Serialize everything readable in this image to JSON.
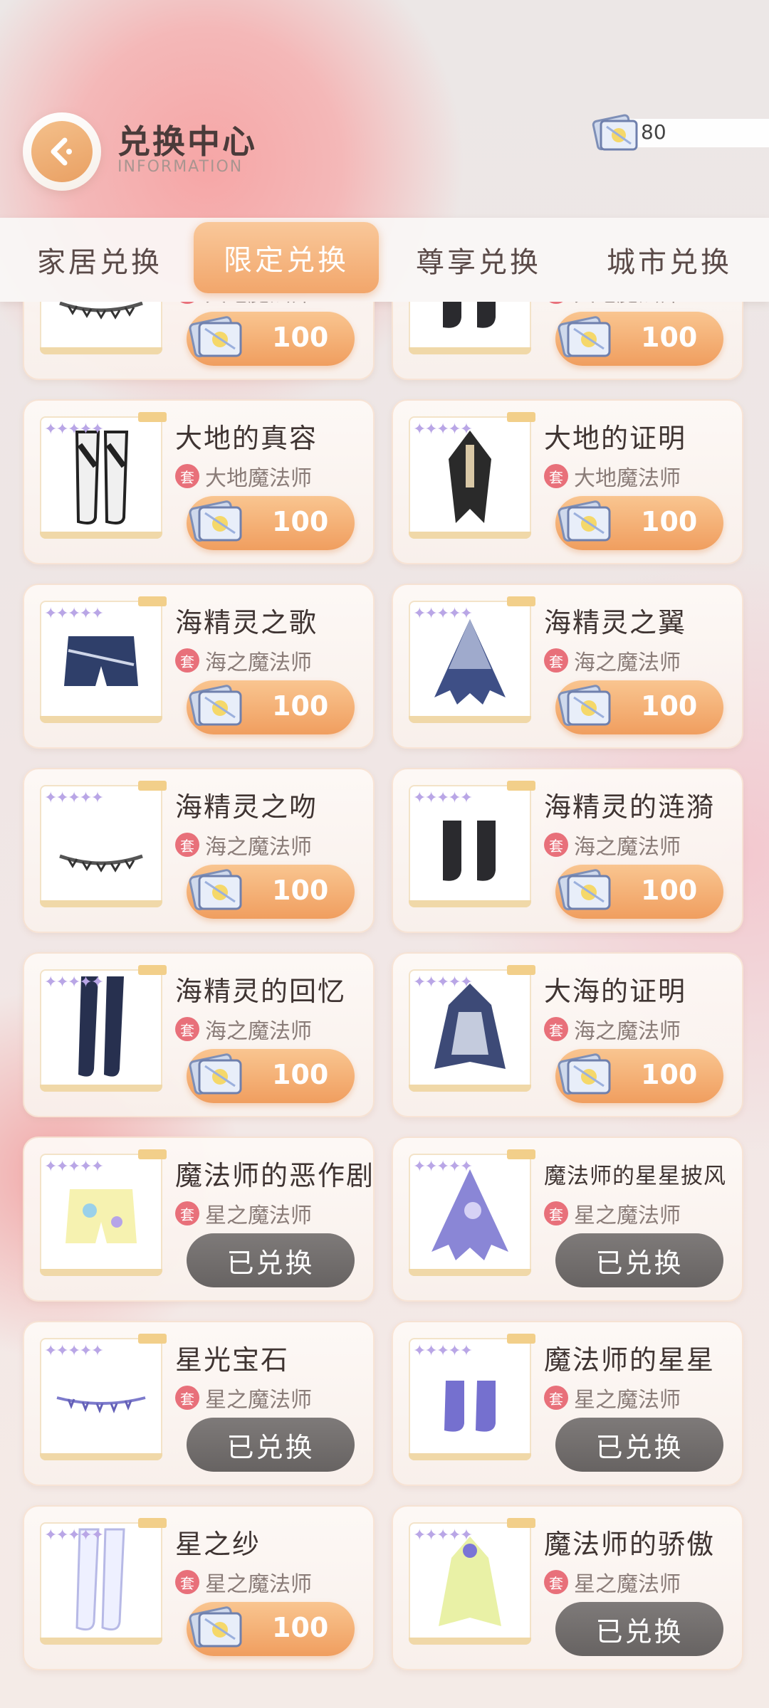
{
  "header": {
    "title": "兑换中心",
    "subtitle": "INFORMATION",
    "currency_value": "80",
    "back_icon": "back-arrow-icon"
  },
  "tabs": [
    "家居兑换",
    "限定兑换",
    "尊享兑换",
    "城市兑换"
  ],
  "active_tab": "限定兑换",
  "set_badge_text": "套",
  "redeemed_label": "已兑换",
  "items": [
    {
      "name": "",
      "set": "大地魔法师",
      "price": "100",
      "redeemed": false,
      "art": "necklace"
    },
    {
      "name": "",
      "set": "大地魔法师",
      "price": "100",
      "redeemed": false,
      "art": "shoes"
    },
    {
      "name": "大地的真容",
      "set": "大地魔法师",
      "price": "100",
      "redeemed": false,
      "art": "boots"
    },
    {
      "name": "大地的证明",
      "set": "大地魔法师",
      "price": "100",
      "redeemed": false,
      "art": "cape"
    },
    {
      "name": "海精灵之歌",
      "set": "海之魔法师",
      "price": "100",
      "redeemed": false,
      "art": "shorts"
    },
    {
      "name": "海精灵之翼",
      "set": "海之魔法师",
      "price": "100",
      "redeemed": false,
      "art": "wing"
    },
    {
      "name": "海精灵之吻",
      "set": "海之魔法师",
      "price": "100",
      "redeemed": false,
      "art": "necklace"
    },
    {
      "name": "海精灵的涟漪",
      "set": "海之魔法师",
      "price": "100",
      "redeemed": false,
      "art": "shoes"
    },
    {
      "name": "海精灵的回忆",
      "set": "海之魔法师",
      "price": "100",
      "redeemed": false,
      "art": "stockings"
    },
    {
      "name": "大海的证明",
      "set": "海之魔法师",
      "price": "100",
      "redeemed": false,
      "art": "dress"
    },
    {
      "name": "魔法师的恶作剧",
      "set": "星之魔法师",
      "price": "",
      "redeemed": true,
      "art": "shorts-star"
    },
    {
      "name": "魔法师的星星披风",
      "set": "星之魔法师",
      "price": "",
      "redeemed": true,
      "art": "cape-star"
    },
    {
      "name": "星光宝石",
      "set": "星之魔法师",
      "price": "",
      "redeemed": true,
      "art": "chain-star"
    },
    {
      "name": "魔法师的星星",
      "set": "星之魔法师",
      "price": "",
      "redeemed": true,
      "art": "shoes-star"
    },
    {
      "name": "星之纱",
      "set": "星之魔法师",
      "price": "100",
      "redeemed": false,
      "art": "stockings-white"
    },
    {
      "name": "魔法师的骄傲",
      "set": "星之魔法师",
      "price": "",
      "redeemed": true,
      "art": "dress-star"
    }
  ],
  "colors": {
    "accent": "#f2a66b",
    "redeemed": "#6f6b6a",
    "badge": "#e8707a"
  }
}
